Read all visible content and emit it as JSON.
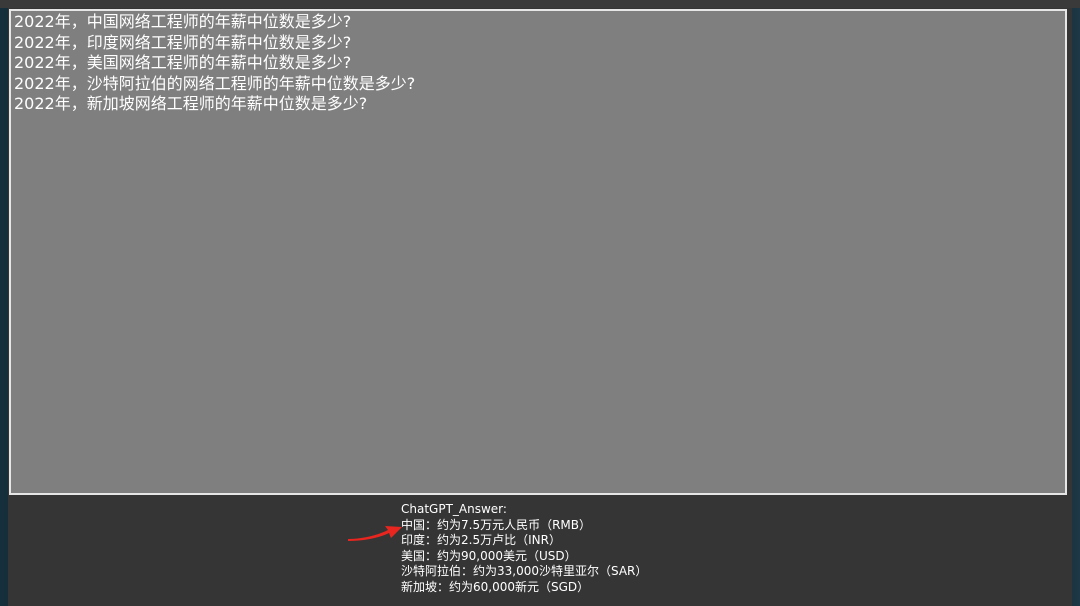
{
  "editor": {
    "text": "2022年，中国网络工程师的年薪中位数是多少?\n2022年，印度网络工程师的年薪中位数是多少?\n2022年，美国网络工程师的年薪中位数是多少?\n2022年，沙特阿拉伯的网络工程师的年薪中位数是多少?\n2022年，新加坡网络工程师的年薪中位数是多少?"
  },
  "answer": {
    "heading": "ChatGPT_Answer:",
    "lines": [
      "中国：约为7.5万元人民币（RMB）",
      "印度：约为2.5万卢比（INR）",
      "美国：约为90,000美元（USD）",
      "沙特阿拉伯：约为33,000沙特里亚尔（SAR）",
      "新加坡：约为60,000新元（SGD）"
    ]
  },
  "colors": {
    "editor_bg": "#7f7f7f",
    "window_bg": "#353535",
    "arrow": "#e8261f"
  },
  "icons": {
    "pointer": "red-arrow-icon"
  }
}
